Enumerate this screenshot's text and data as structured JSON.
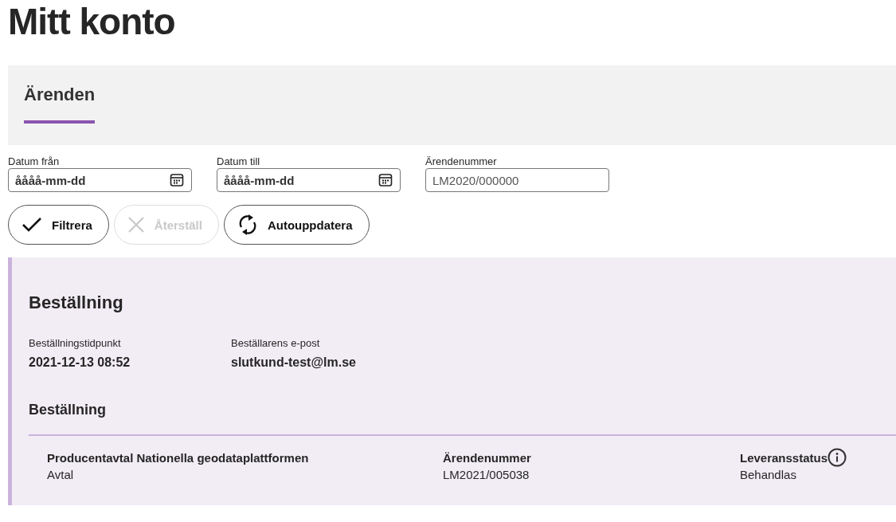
{
  "page_title": "Mitt konto",
  "tabs": [
    {
      "label": "Ärenden",
      "selected": true
    }
  ],
  "filters": [
    {
      "kind": "date",
      "label": "Datum från",
      "placeholder": "åååå-mm-dd"
    },
    {
      "kind": "date",
      "label": "Datum till",
      "placeholder": "åååå-mm-dd"
    },
    {
      "kind": "text",
      "label": "Ärendenummer",
      "placeholder": "LM2020/000000"
    }
  ],
  "buttons": [
    {
      "kind": "check",
      "label": "Filtrera",
      "disabled": false
    },
    {
      "kind": "close",
      "label": "Återställ",
      "disabled": true
    },
    {
      "kind": "refresh",
      "label": "Autouppdatera",
      "disabled": false
    }
  ],
  "order": {
    "title": "Beställning",
    "fields": [
      {
        "label": "Beställningstidpunkt",
        "value": "2021-12-13 08:52"
      },
      {
        "label": "Beställarens e-post",
        "value": "slutkund-test@lm.se"
      }
    ],
    "section_title": "Beställning",
    "items": [
      {
        "label": "Producentavtal Nationella geodataplattformen",
        "value": "Avtal",
        "info": false
      },
      {
        "label": "Ärendenummer",
        "value": "LM2021/005038",
        "info": false
      },
      {
        "label": "Leveransstatus",
        "value": "Behandlas",
        "info": true
      }
    ]
  }
}
